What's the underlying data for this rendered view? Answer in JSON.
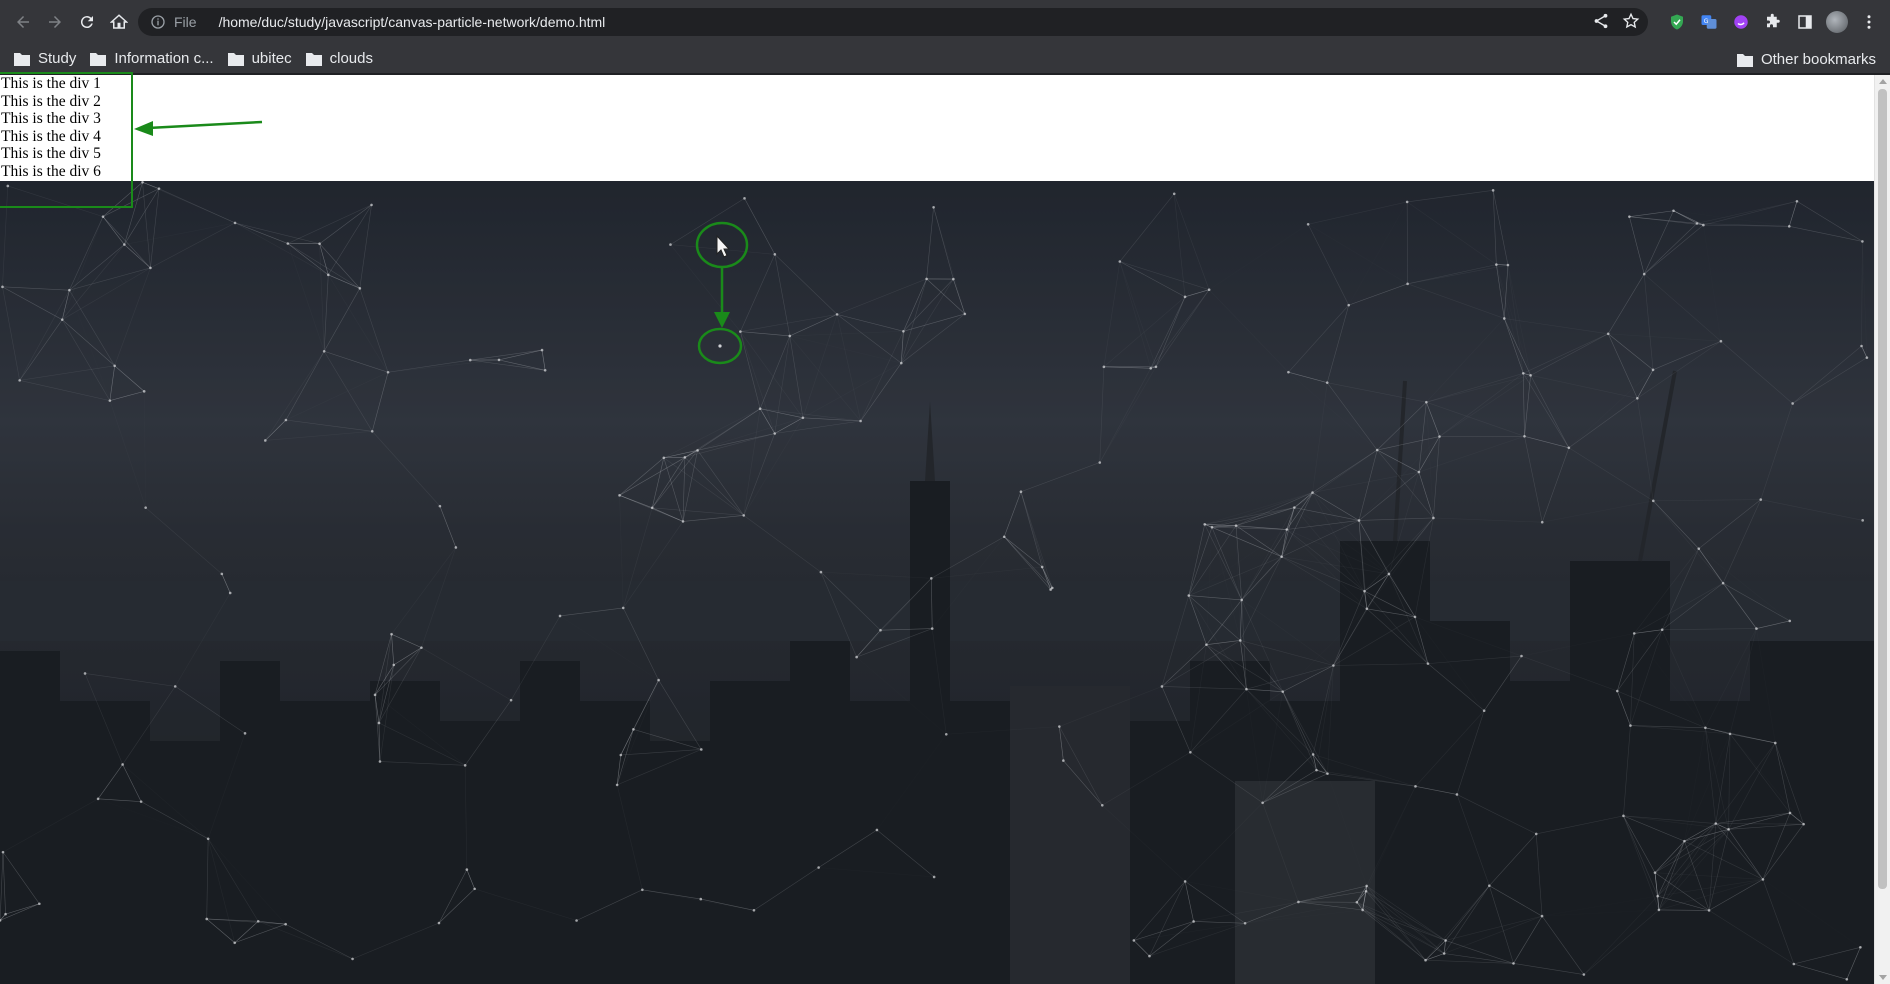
{
  "browser": {
    "scheme_label": "File",
    "url": "/home/duc/study/javascript/canvas-particle-network/demo.html",
    "icons": [
      "back-arrow-icon",
      "forward-arrow-icon",
      "reload-icon",
      "home-icon",
      "info-icon",
      "share-icon",
      "star-icon",
      "shield-icon",
      "translate-icon",
      "extension-purple-icon",
      "puzzle-icon",
      "sidebar-icon",
      "profile-avatar",
      "menu-kebab-icon"
    ]
  },
  "bookmarks": {
    "items": [
      {
        "label": "Study"
      },
      {
        "label": "Information c..."
      },
      {
        "label": "ubitec"
      },
      {
        "label": "clouds"
      }
    ],
    "other_label": "Other bookmarks"
  },
  "page": {
    "divs": [
      {
        "text": "This is the div 1"
      },
      {
        "text": "This is the div 2"
      },
      {
        "text": "This is the div 3"
      },
      {
        "text": "This is the div 4"
      },
      {
        "text": "This is the div 5"
      },
      {
        "text": "This is the div 6"
      }
    ]
  },
  "colors": {
    "annotation": "#1a8a1a",
    "toolbar": "#35363a",
    "omnibox": "#202124",
    "particle_line": "#c9ccd1"
  }
}
